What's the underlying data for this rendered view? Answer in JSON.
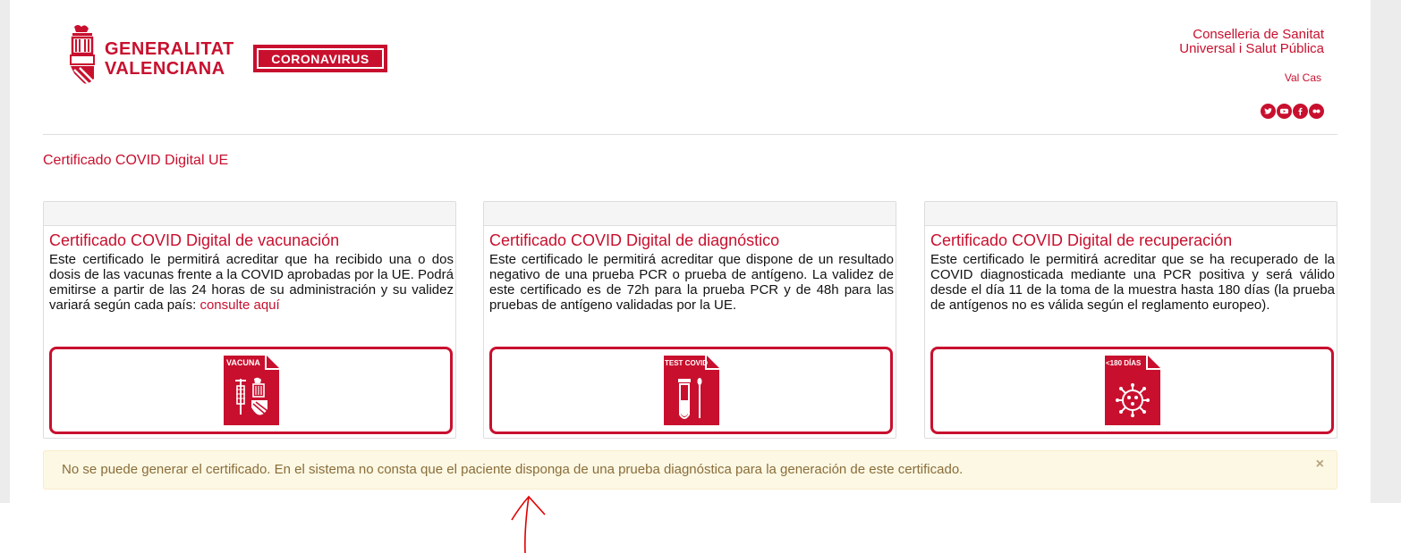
{
  "header": {
    "gva_line1": "GENERALITAT",
    "gva_line2": "VALENCIANA",
    "coronavirus_label": "CORONAVIRUS",
    "dept_line1": "Conselleria de Sanitat",
    "dept_line2": "Universal i Salut Pública",
    "lang_link": "Val Cas",
    "social_icons": [
      "twitter-icon",
      "youtube-icon",
      "facebook-icon",
      "flickr-icon"
    ]
  },
  "main": {
    "section_title": "Certificado COVID Digital UE",
    "cards": [
      {
        "title": "Certificado COVID Digital de vacunación",
        "desc": "Este certificado le permitirá acreditar que ha recibido una o dos dosis de las vacunas frente a la COVID aprobadas por la UE. Podrá emitirse a partir de las 24 horas de su administración y su validez variará según cada país: ",
        "link": "consulte aquí",
        "icon_label": "VACUNA",
        "icon": "vaccine-document-icon"
      },
      {
        "title": "Certificado COVID Digital de diagnóstico",
        "desc": "Este certificado le permitirá acreditar que dispone de un resultado negativo de una prueba PCR o prueba de antígeno. La validez de este certificado es de 72h para la prueba PCR y de 48h para las pruebas de antígeno validadas por la UE.",
        "icon_label": "TEST COVID",
        "icon": "test-tube-document-icon"
      },
      {
        "title": "Certificado COVID Digital de recuperación",
        "desc": "Este certificado le permitirá acreditar que se ha recuperado de la COVID diagnosticada mediante una PCR positiva y será válido desde el día 11 de la toma de la muestra hasta 180 días (la prueba de antígenos no es válida según el reglamento europeo).",
        "icon_label": "<180 DÍAS",
        "icon": "virus-document-icon"
      }
    ]
  },
  "alert": {
    "text": "No se puede generar el certificado. En el sistema no consta que el paciente disponga de una prueba diagnóstica para la generación de este certificado.",
    "close": "×"
  },
  "colors": {
    "brand": "#c8102e",
    "alert_bg": "#fcf8e3",
    "alert_text": "#8a6d3b",
    "annotation_arrow": "#e00000"
  }
}
